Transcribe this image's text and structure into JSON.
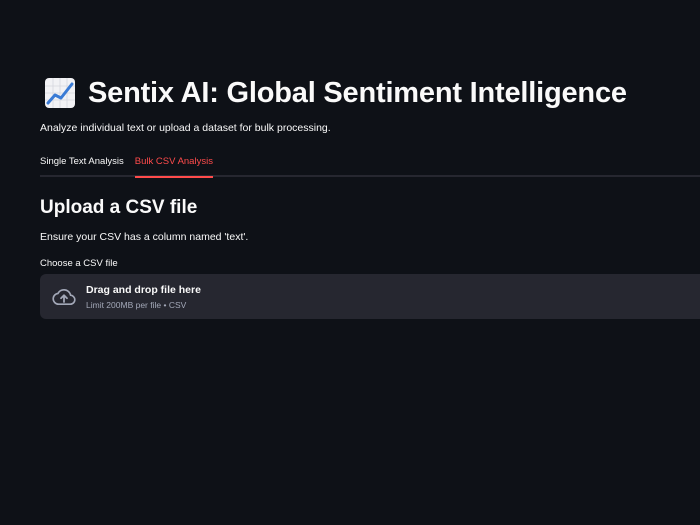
{
  "header": {
    "emoji_icon": "chart-increasing-icon",
    "title": "Sentix AI: Global Sentiment Intelligence",
    "subtitle": "Analyze individual text or upload a dataset for bulk processing."
  },
  "tabs": [
    {
      "label": "Single Text Analysis",
      "active": false
    },
    {
      "label": "Bulk CSV Analysis",
      "active": true
    }
  ],
  "upload_section": {
    "heading": "Upload a CSV file",
    "instruction": "Ensure your CSV has a column named 'text'.",
    "uploader_label": "Choose a CSV file",
    "dropzone": {
      "icon": "cloud-upload-icon",
      "main_text": "Drag and drop file here",
      "limit_text": "Limit 200MB per file • CSV"
    }
  },
  "colors": {
    "background": "#0e1117",
    "surface": "#262730",
    "accent": "#ff4b4b",
    "text": "#fafafa",
    "muted": "#a3a8b8"
  }
}
